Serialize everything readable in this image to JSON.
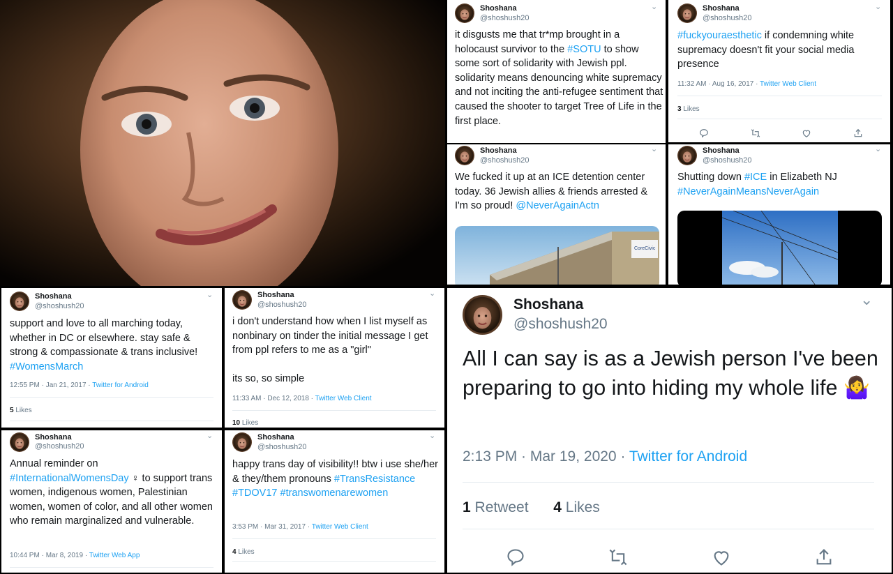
{
  "user": {
    "name": "Shoshana",
    "handle": "@shoshush20"
  },
  "tweets": {
    "t1": {
      "parts": [
        {
          "text": "it disgusts me that tr*mp brought in a holocaust survivor to the ",
          "tag": false
        },
        {
          "text": "#SOTU",
          "tag": true
        },
        {
          "text": " to show some sort of solidarity with Jewish ppl. solidarity means denouncing white supremacy and not inciting the anti-refugee sentiment that caused the shooter to target Tree of Life in the first place.",
          "tag": false
        }
      ]
    },
    "t2": {
      "parts": [
        {
          "text": "#fuckyouraesthetic",
          "tag": true
        },
        {
          "text": " if condemning white supremacy doesn't fit your social media presence",
          "tag": false
        }
      ],
      "time": "11:32 AM · Aug 16, 2017 · ",
      "source": "Twitter Web Client",
      "likes_num": "3",
      "likes_label": " Likes"
    },
    "t3": {
      "parts": [
        {
          "text": "We fucked it up at an ICE detention center today. 36 Jewish allies & friends arrested & I'm so proud!  ",
          "tag": false
        },
        {
          "text": "@NeverAgainActn",
          "tag": true
        }
      ],
      "sign": "CoreCivic"
    },
    "t4": {
      "parts": [
        {
          "text": "Shutting down ",
          "tag": false
        },
        {
          "text": "#ICE",
          "tag": true
        },
        {
          "text": " in Elizabeth NJ ",
          "tag": false
        },
        {
          "text": "#NeverAgainMeansNeverAgain",
          "tag": true
        }
      ]
    },
    "t5": {
      "parts": [
        {
          "text": "support and love to all marching today, whether in DC or elsewhere. stay safe & strong & compassionate & trans inclusive! ",
          "tag": false
        },
        {
          "text": "#WomensMarch",
          "tag": true
        }
      ],
      "time": "12:55 PM · Jan 21, 2017 · ",
      "source": "Twitter for Android",
      "likes_num": "5",
      "likes_label": " Likes"
    },
    "t6": {
      "parts": [
        {
          "text": "i don't understand how when I list myself as nonbinary on tinder the initial message I get from ppl refers to me as a \"girl\"\n\nits so, so simple",
          "tag": false
        }
      ],
      "time": "11:33 AM · Dec 12, 2018 · ",
      "source": "Twitter Web Client",
      "likes_num": "10",
      "likes_label": " Likes"
    },
    "t7": {
      "parts": [
        {
          "text": "Annual reminder on ",
          "tag": false
        },
        {
          "text": "#InternationalWomensDay",
          "tag": true
        },
        {
          "text": " ♀ ",
          "tag": false
        },
        {
          "text": "to support trans women, indigenous women, Palestinian women, women of color, and all other women who remain marginalized and vulnerable.",
          "tag": false
        }
      ],
      "time": "10:44 PM · Mar 8, 2019 · ",
      "source": "Twitter Web App"
    },
    "t8": {
      "parts": [
        {
          "text": "happy trans day of visibility!! btw i use she/her & they/them pronouns ",
          "tag": false
        },
        {
          "text": "#TransResistance",
          "tag": true
        },
        {
          "text": " ",
          "tag": false
        },
        {
          "text": "#TDOV17",
          "tag": true
        },
        {
          "text": " ",
          "tag": false
        },
        {
          "text": "#transwomenarewomen",
          "tag": true
        }
      ],
      "time": "3:53 PM · Mar 31, 2017 · ",
      "source": "Twitter Web Client",
      "likes_num": "4",
      "likes_label": " Likes"
    },
    "t9": {
      "parts": [
        {
          "text": "All I can say is as a Jewish person I've been preparing to go into hiding my whole life ",
          "tag": false
        },
        {
          "text": "🤷‍♀️",
          "tag": false
        }
      ],
      "time": "2:13 PM · Mar 19, 2020 · ",
      "source": "Twitter for Android",
      "retweets_num": "1",
      "retweets_label": " Retweet",
      "likes_num": "4",
      "likes_label": " Likes"
    }
  },
  "icons": {
    "chevron": "chevron-down-icon",
    "reply": "reply-icon",
    "retweet": "retweet-icon",
    "like": "heart-icon",
    "share": "share-icon"
  },
  "colors": {
    "link": "#1da1f2",
    "text": "#14171a",
    "muted": "#657786",
    "divider": "#e6ecf0"
  }
}
